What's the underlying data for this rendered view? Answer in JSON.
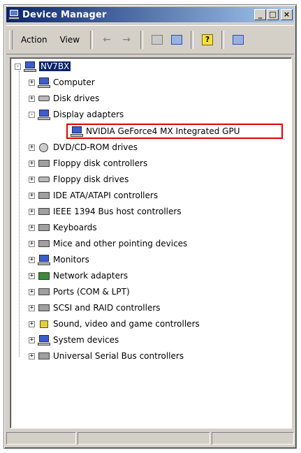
{
  "window": {
    "title": "Device Manager",
    "buttons": {
      "minimize": "_",
      "maximize": "□",
      "close": "×"
    }
  },
  "menu": {
    "action": "Action",
    "view": "View"
  },
  "toolbar": {
    "icons": [
      "back-arrow-icon",
      "forward-arrow-icon",
      "view-icon",
      "properties-icon",
      "help-icon",
      "scan-hardware-icon"
    ]
  },
  "tree": {
    "root": {
      "label": "NV7BX",
      "icon": "computer-icon"
    },
    "items": [
      {
        "label": "Computer",
        "icon": "computer-icon",
        "expanded": false
      },
      {
        "label": "Disk drives",
        "icon": "disk-drive-icon",
        "expanded": false
      },
      {
        "label": "Display adapters",
        "icon": "monitor-icon",
        "expanded": true,
        "children": [
          {
            "label": "NVIDIA GeForce4 MX Integrated GPU",
            "icon": "display-adapter-icon",
            "highlighted": true
          }
        ]
      },
      {
        "label": "DVD/CD-ROM drives",
        "icon": "cdrom-icon",
        "expanded": false
      },
      {
        "label": "Floppy disk controllers",
        "icon": "controller-icon",
        "expanded": false
      },
      {
        "label": "Floppy disk drives",
        "icon": "floppy-drive-icon",
        "expanded": false
      },
      {
        "label": "IDE ATA/ATAPI controllers",
        "icon": "controller-icon",
        "expanded": false
      },
      {
        "label": "IEEE 1394 Bus host controllers",
        "icon": "controller-icon",
        "expanded": false
      },
      {
        "label": "Keyboards",
        "icon": "keyboard-icon",
        "expanded": false
      },
      {
        "label": "Mice and other pointing devices",
        "icon": "mouse-icon",
        "expanded": false
      },
      {
        "label": "Monitors",
        "icon": "monitor-icon",
        "expanded": false
      },
      {
        "label": "Network adapters",
        "icon": "network-icon",
        "expanded": false
      },
      {
        "label": "Ports (COM & LPT)",
        "icon": "port-icon",
        "expanded": false
      },
      {
        "label": "SCSI and RAID controllers",
        "icon": "controller-icon",
        "expanded": false
      },
      {
        "label": "Sound, video and game controllers",
        "icon": "sound-icon",
        "expanded": false
      },
      {
        "label": "System devices",
        "icon": "computer-icon",
        "expanded": false
      },
      {
        "label": "Universal Serial Bus controllers",
        "icon": "usb-icon",
        "expanded": false
      }
    ]
  },
  "colors": {
    "title_gradient_start": "#0a246a",
    "title_gradient_end": "#a6caf0",
    "highlight_border": "#e00000",
    "selection": "#0a246a"
  }
}
